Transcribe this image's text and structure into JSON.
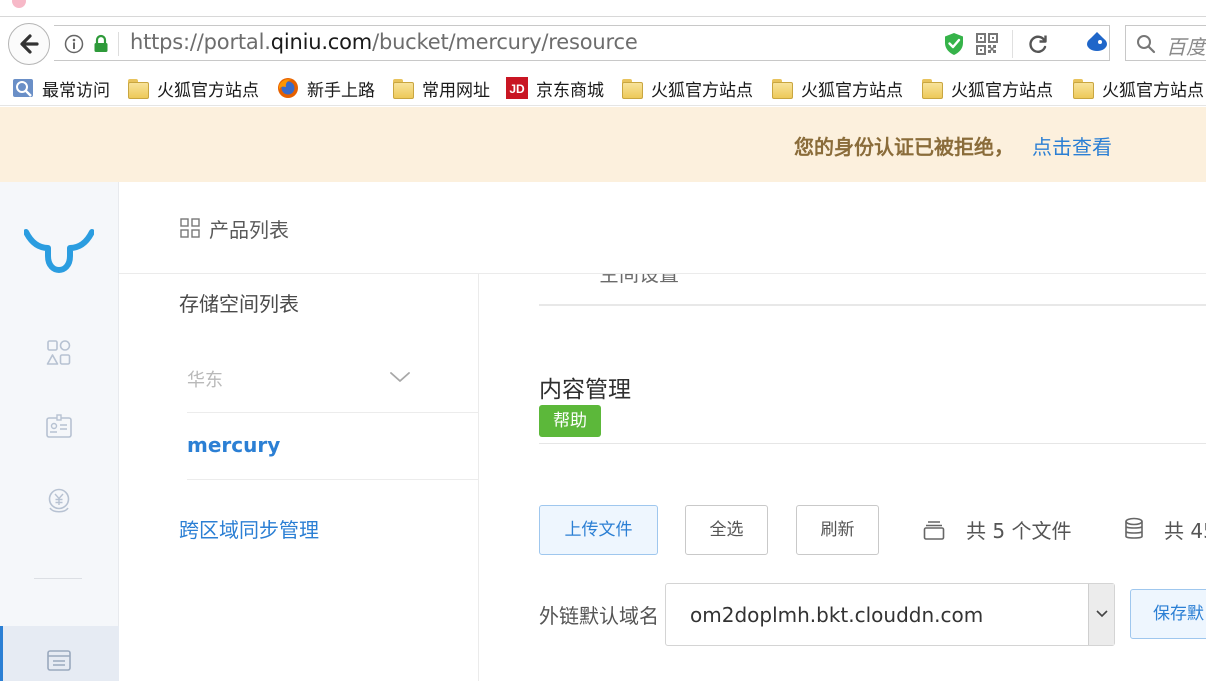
{
  "browser": {
    "url_scheme": "https://portal.",
    "url_host": "qiniu.com",
    "url_path": "/bucket/mercury/resource",
    "search_placeholder": "百度"
  },
  "bookmarks": [
    {
      "label": "最常访问",
      "icon": "most-visited-icon"
    },
    {
      "label": "火狐官方站点",
      "icon": "folder-icon"
    },
    {
      "label": "新手上路",
      "icon": "firefox-icon"
    },
    {
      "label": "常用网址",
      "icon": "folder-icon"
    },
    {
      "label": "京东商城",
      "icon": "jd-icon"
    },
    {
      "label": "火狐官方站点",
      "icon": "folder-icon"
    },
    {
      "label": "火狐官方站点",
      "icon": "folder-icon"
    },
    {
      "label": "火狐官方站点",
      "icon": "folder-icon"
    },
    {
      "label": "火狐官方站点",
      "icon": "folder-icon"
    }
  ],
  "notice": {
    "text": "您的身份认证已被拒绝，",
    "link": "点击查看"
  },
  "topbar": {
    "title": "产品列表"
  },
  "subnav": {
    "title": "存储空间列表",
    "region": "华东",
    "bucket": "mercury",
    "cross_region": "跨区域同步管理"
  },
  "main": {
    "cut_text": "空间设置",
    "section_title": "内容管理",
    "help_badge": "帮助",
    "upload_label": "上传文件",
    "select_all_label": "全选",
    "refresh_label": "刷新",
    "file_count_text": "共 5 个文件",
    "storage_text": "共 45",
    "domain_label": "外链默认域名",
    "domain_value": "om2doplmh.bkt.clouddn.com",
    "save_label": "保存默"
  },
  "colors": {
    "accent": "#2b7fd4",
    "help_green": "#5cb83a",
    "notice_bg": "#fcf0dd",
    "notice_text": "#8a6c3a"
  }
}
